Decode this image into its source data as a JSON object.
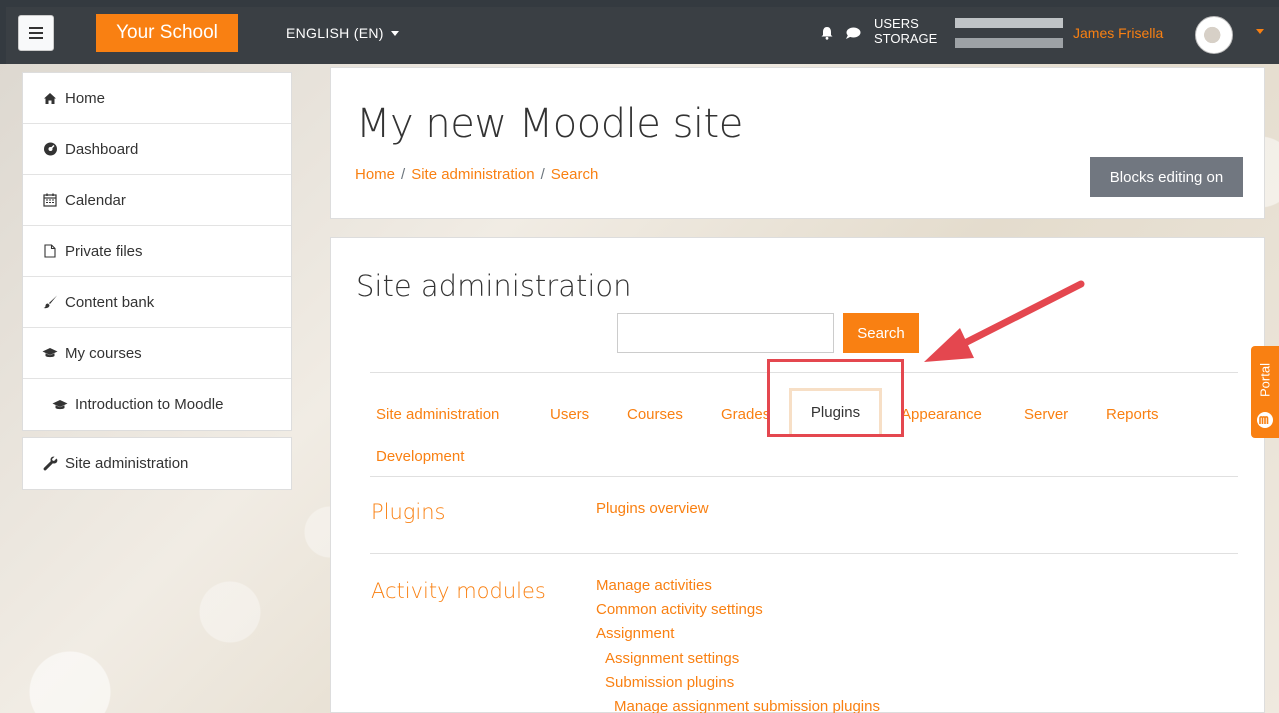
{
  "navbar": {
    "brand": "Your School",
    "language": "ENGLISH (EN)",
    "storage_labels": [
      "USERS",
      "STORAGE"
    ],
    "users_fraction": 1.0,
    "storage_fraction": 1.0,
    "username": "James Frisella"
  },
  "drawer": {
    "items": [
      {
        "label": "Home",
        "icon": "home-icon"
      },
      {
        "label": "Dashboard",
        "icon": "dashboard-icon"
      },
      {
        "label": "Calendar",
        "icon": "calendar-icon"
      },
      {
        "label": "Private files",
        "icon": "file-icon"
      },
      {
        "label": "Content bank",
        "icon": "paintbrush-icon"
      },
      {
        "label": "My courses",
        "icon": "graduation-cap-icon"
      },
      {
        "label": "Introduction to Moodle",
        "icon": "graduation-cap-icon"
      }
    ],
    "admin_item": {
      "label": "Site administration",
      "icon": "wrench-icon"
    }
  },
  "header": {
    "title": "My new Moodle site",
    "breadcrumb": [
      "Home",
      "Site administration",
      "Search"
    ],
    "blocks_button": "Blocks editing on"
  },
  "admin": {
    "heading": "Site administration",
    "search_button": "Search",
    "search_value": "",
    "tabs": [
      "Site administration",
      "Users",
      "Courses",
      "Grades",
      "Plugins",
      "Appearance",
      "Server",
      "Reports",
      "Development"
    ],
    "active_tab": "Plugins",
    "sections": [
      {
        "title": "Plugins",
        "links": [
          "Plugins overview"
        ]
      },
      {
        "title": "Activity modules",
        "links": [
          "Manage activities",
          "Common activity settings",
          "Assignment",
          "Assignment settings",
          "Submission plugins",
          "Manage assignment submission plugins"
        ]
      }
    ]
  },
  "portal": {
    "label": "Portal"
  },
  "colors": {
    "accent": "#f98012",
    "navbar": "#343a40",
    "annotation": "#e4474f"
  }
}
